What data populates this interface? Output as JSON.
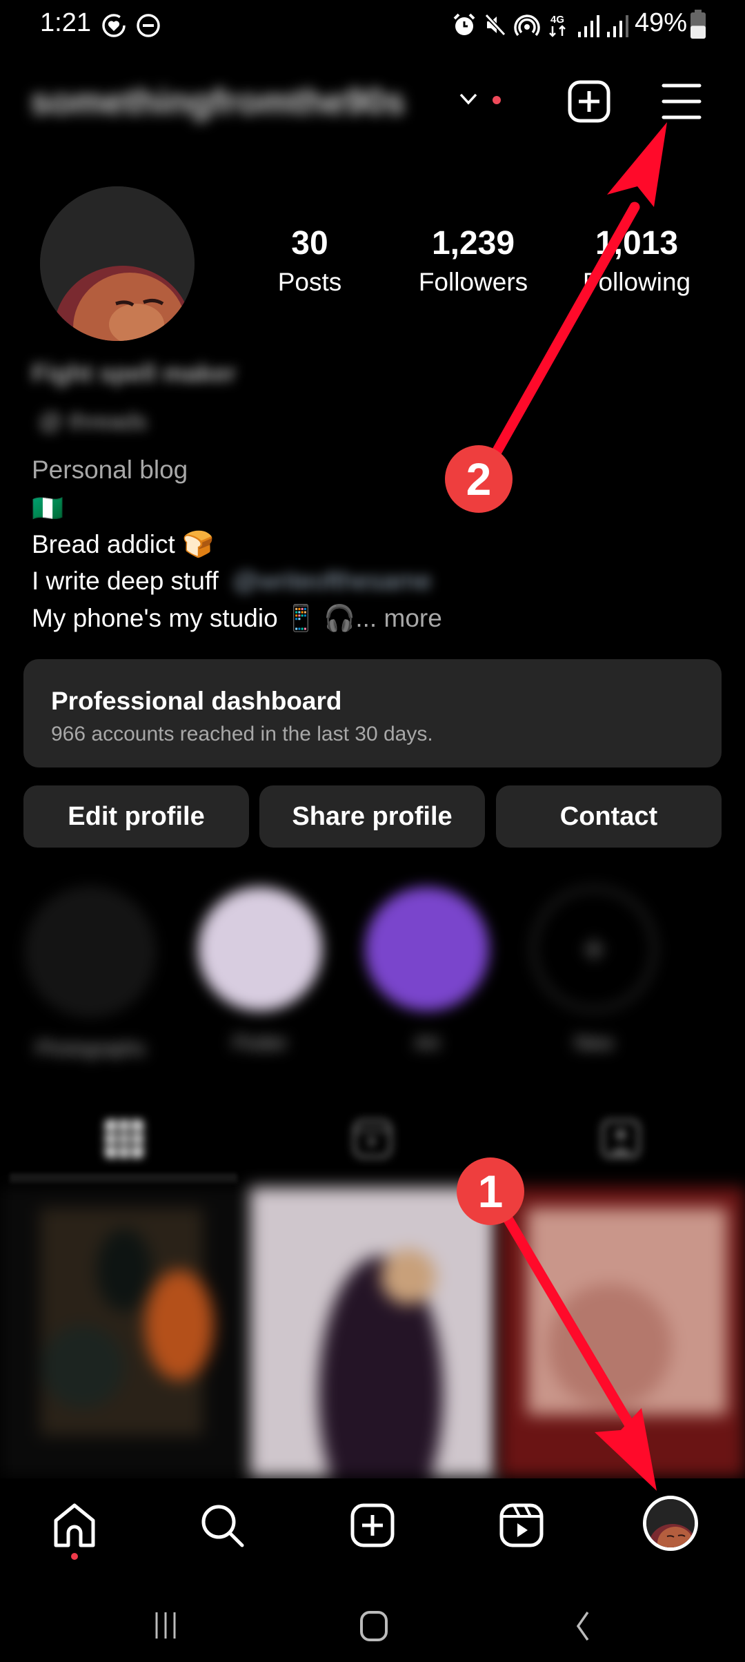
{
  "status_bar": {
    "time": "1:21",
    "left_icons": [
      "heart-sync-icon",
      "do-not-disturb-icon"
    ],
    "right_icons": [
      "alarm-icon",
      "mute-icon",
      "hotspot-icon",
      "4g-data-icon",
      "signal-icon",
      "signal-icon-2"
    ],
    "network_label": "4G",
    "battery": "49%",
    "battery_level": 0.49
  },
  "header": {
    "username": "somethingfromthe90s",
    "username_blurred": true,
    "has_notification_dot": true,
    "new_post_icon": "plus-square-icon",
    "menu_icon": "hamburger-menu-icon"
  },
  "profile": {
    "stats": [
      {
        "value": "30",
        "label": "Posts"
      },
      {
        "value": "1,239",
        "label": "Followers"
      },
      {
        "value": "1,013",
        "label": "Following"
      }
    ],
    "blurred_name": "Fight spell maker",
    "blurred_handle": "@ threads",
    "category": "Personal blog",
    "bio_flag": "🇳🇬",
    "bio_lines": [
      "Bread addict 🍞",
      "I write deep stuff",
      "My phone's my studio 📱 🎧"
    ],
    "bio_link_blurred": "@writeofthesame",
    "more_label": "... more"
  },
  "dashboard": {
    "title": "Professional dashboard",
    "subtitle": "966 accounts reached in the last 30 days."
  },
  "actions": {
    "edit": "Edit profile",
    "share": "Share profile",
    "contact": "Contact"
  },
  "highlights": [
    {
      "label": "Photographs",
      "color": "#141414"
    },
    {
      "label": "Flutter",
      "color": "#d8cde0"
    },
    {
      "label": "Art",
      "color": "#7a45cc"
    },
    {
      "label": "New",
      "color": "#000000"
    }
  ],
  "tabs": [
    {
      "name": "grid",
      "icon": "grid-icon",
      "active": true
    },
    {
      "name": "reels",
      "icon": "reels-icon",
      "active": false
    },
    {
      "name": "tagged",
      "icon": "tagged-icon",
      "active": false
    }
  ],
  "posts": [
    {
      "colors": [
        "#2a1a12",
        "#b4501a",
        "#1a2222"
      ]
    },
    {
      "colors": [
        "#cfc6cc",
        "#2a1628",
        "#d6cfd4"
      ]
    },
    {
      "colors": [
        "#6a1616",
        "#d6a898",
        "#7a1818"
      ]
    }
  ],
  "bottom_nav": [
    {
      "name": "home",
      "icon": "home-icon",
      "has_dot": true
    },
    {
      "name": "search",
      "icon": "search-icon"
    },
    {
      "name": "create",
      "icon": "plus-square-icon"
    },
    {
      "name": "reels",
      "icon": "reels-icon"
    },
    {
      "name": "profile",
      "icon": "avatar",
      "active": true
    }
  ],
  "system_nav": [
    "recents-icon",
    "home-circle-icon",
    "back-icon"
  ],
  "annotations": [
    {
      "number": "1",
      "target": "profile tab in bottom navigation"
    },
    {
      "number": "2",
      "target": "hamburger menu"
    }
  ],
  "colors": {
    "background": "#000000",
    "card": "#262626",
    "secondary_text": "#a8a8a8",
    "annotation_red": "#ee3e3e",
    "arrow_red": "#ff0a2a"
  }
}
